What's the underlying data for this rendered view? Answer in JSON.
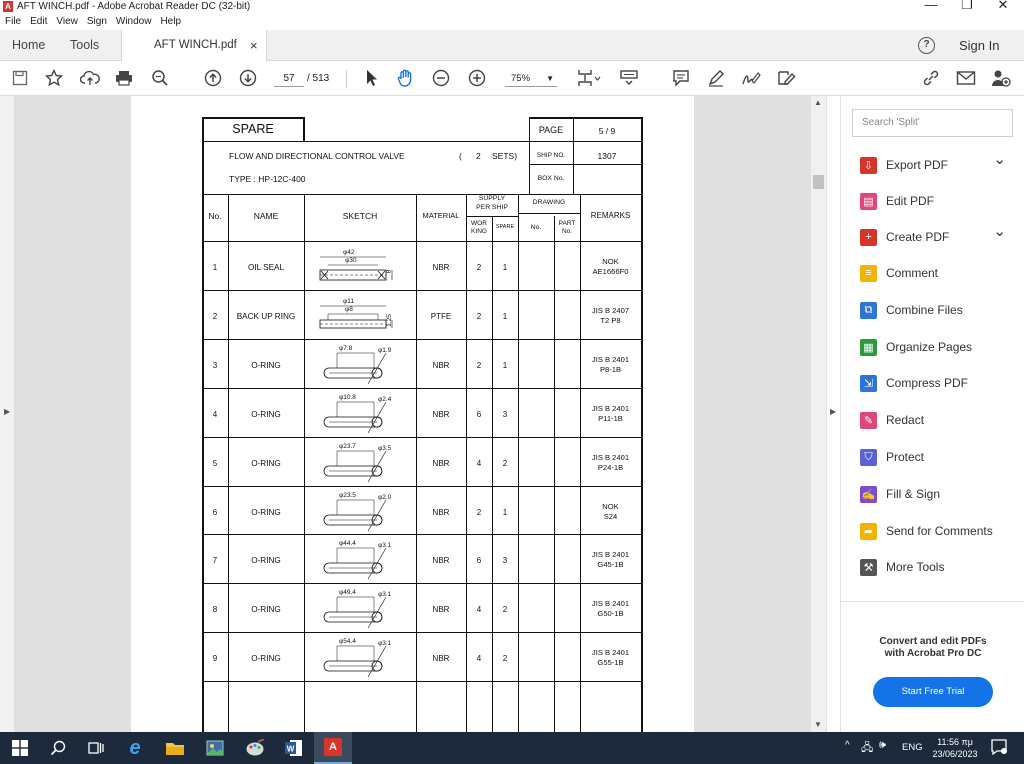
{
  "window": {
    "title": "AFT WINCH.pdf - Adobe Acrobat Reader DC (32-bit)",
    "minimize": "—",
    "restore": "❐",
    "close": "✕"
  },
  "menu": [
    "File",
    "Edit",
    "View",
    "Sign",
    "Window",
    "Help"
  ],
  "tabs": {
    "home": "Home",
    "tools": "Tools",
    "document": "AFT WINCH.pdf",
    "close": "×",
    "help": "?",
    "sign_in": "Sign In"
  },
  "toolbar": {
    "current_page": "57",
    "total_pages": "/ 513",
    "zoom": "75%"
  },
  "sheet": {
    "header": "SPARE",
    "page_label": "PAGE",
    "page_value": "5 / 9",
    "description": "FLOW AND DIRECTIONAL CONTROL VALVE",
    "sets_open": "(",
    "sets_count": "2",
    "sets_close": "SETS)",
    "ship_no_label": "SHIP NO.",
    "ship_no_value": "1307",
    "type": "TYPE : HP-12C-400",
    "box_no_label": "BOX No.",
    "columns": {
      "no": "No.",
      "name": "NAME",
      "sketch": "SKETCH",
      "material": "MATERIAL",
      "supply": "SUPPLY",
      "per_ship": "PER SHIP",
      "working_1": "WOR",
      "working_2": "KING",
      "spare": "SPARE",
      "drawing": "DRAWING",
      "drawing_no": "No.",
      "part_1": "PART",
      "part_2": "No.",
      "remarks": "REMARKS"
    },
    "rows": [
      {
        "no": "1",
        "name": "OIL SEAL",
        "material": "NBR",
        "working": "2",
        "spare": "1",
        "remarks_1": "NOK",
        "remarks_2": "AE1666F0",
        "dim_1": "φ42",
        "dim_2": "φ30",
        "dim_3": "8"
      },
      {
        "no": "2",
        "name": "BACK UP RING",
        "material": "PTFE",
        "working": "2",
        "spare": "1",
        "remarks_1": "JIS B 2407",
        "remarks_2": "T2 P8",
        "dim_1": "φ11",
        "dim_2": "φ8",
        "dim_3": "1.25"
      },
      {
        "no": "3",
        "name": "O-RING",
        "material": "NBR",
        "working": "2",
        "spare": "1",
        "remarks_1": "JIS B 2401",
        "remarks_2": "P8-1B",
        "dim_1": "φ7.8",
        "dim_2": "φ1.9"
      },
      {
        "no": "4",
        "name": "O-RING",
        "material": "NBR",
        "working": "6",
        "spare": "3",
        "remarks_1": "JIS B 2401",
        "remarks_2": "P11-1B",
        "dim_1": "φ10.8",
        "dim_2": "φ2.4"
      },
      {
        "no": "5",
        "name": "O-RING",
        "material": "NBR",
        "working": "4",
        "spare": "2",
        "remarks_1": "JIS B 2401",
        "remarks_2": "P24-1B",
        "dim_1": "φ23.7",
        "dim_2": "φ3.5"
      },
      {
        "no": "6",
        "name": "O-RING",
        "material": "NBR",
        "working": "2",
        "spare": "1",
        "remarks_1": "NOK",
        "remarks_2": "S24",
        "dim_1": "φ23.5",
        "dim_2": "φ2.0"
      },
      {
        "no": "7",
        "name": "O-RING",
        "material": "NBR",
        "working": "6",
        "spare": "3",
        "remarks_1": "JIS B 2401",
        "remarks_2": "G45-1B",
        "dim_1": "φ44.4",
        "dim_2": "φ3.1"
      },
      {
        "no": "8",
        "name": "O-RING",
        "material": "NBR",
        "working": "4",
        "spare": "2",
        "remarks_1": "JIS B 2401",
        "remarks_2": "G50-1B",
        "dim_1": "φ49.4",
        "dim_2": "φ3.1"
      },
      {
        "no": "9",
        "name": "O-RING",
        "material": "NBR",
        "working": "4",
        "spare": "2",
        "remarks_1": "JIS B 2401",
        "remarks_2": "G55-1B",
        "dim_1": "φ54.4",
        "dim_2": "φ3.1"
      }
    ]
  },
  "side_panel": {
    "search_placeholder": "Search 'Split'",
    "tools": [
      {
        "label": "Export PDF",
        "icon": "export-pdf-icon",
        "color": "#d8352a",
        "glyph": "⇩"
      },
      {
        "label": "Edit PDF",
        "icon": "edit-pdf-icon",
        "color": "#e0457b",
        "glyph": "▤"
      },
      {
        "label": "Create PDF",
        "icon": "create-pdf-icon",
        "color": "#d8352a",
        "glyph": "+"
      },
      {
        "label": "Comment",
        "icon": "comment-icon",
        "color": "#f1b400",
        "glyph": "≡"
      },
      {
        "label": "Combine Files",
        "icon": "combine-files-icon",
        "color": "#2d75d6",
        "glyph": "⧉"
      },
      {
        "label": "Organize Pages",
        "icon": "organize-pages-icon",
        "color": "#2b9a3e",
        "glyph": "▦"
      },
      {
        "label": "Compress PDF",
        "icon": "compress-pdf-icon",
        "color": "#2d75d6",
        "glyph": "⇲"
      },
      {
        "label": "Redact",
        "icon": "redact-icon",
        "color": "#e0457b",
        "glyph": "✎"
      },
      {
        "label": "Protect",
        "icon": "protect-icon",
        "color": "#5b62d6",
        "glyph": "⛉"
      },
      {
        "label": "Fill & Sign",
        "icon": "fill-sign-icon",
        "color": "#7d4ad6",
        "glyph": "✍"
      },
      {
        "label": "Send for Comments",
        "icon": "send-for-comments-icon",
        "color": "#f1b400",
        "glyph": "➦"
      },
      {
        "label": "More Tools",
        "icon": "more-tools-icon",
        "color": "#555555",
        "glyph": "⚒"
      }
    ],
    "promo_line_1": "Convert and edit PDFs",
    "promo_line_2": "with Acrobat Pro DC",
    "trial_button": "Start Free Trial"
  },
  "taskbar": {
    "language": "ENG",
    "time": "11:56 πμ",
    "date": "23/06/2023"
  },
  "colors": {
    "accent": "#1473e6",
    "taskbar": "#1c2a3c",
    "pdf_red": "#d8352a"
  }
}
